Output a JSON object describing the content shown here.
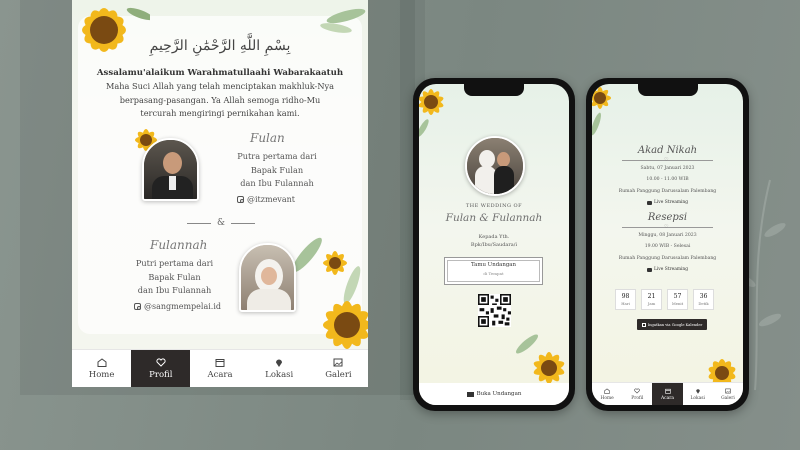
{
  "main_screen": {
    "calligraphy": "بِسْمِ اللَّهِ الرَّحْمَٰنِ الرَّحِيمِ",
    "greeting": "Assalamu'alaikum Warahmatullaahi Wabarakaatuh",
    "opening_lines": [
      "Maha Suci Allah yang telah menciptakan makhluk-Nya",
      "berpasang-pasangan. Ya Allah semoga ridho-Mu",
      "tercurah mengiringi pernikahan kami."
    ],
    "groom": {
      "name": "Fulan",
      "lines": [
        "Putra pertama dari",
        "Bapak Fulan",
        "dan Ibu Fulannah"
      ],
      "instagram": "@itzmevant"
    },
    "ampersand": "&",
    "bride": {
      "name": "Fulannah",
      "lines": [
        "Putri pertama dari",
        "Bapak Fulan",
        "dan Ibu Fulannah"
      ],
      "instagram": "@sangmempelai.id"
    },
    "nav": [
      {
        "label": "Home",
        "icon": "home-icon",
        "active": false
      },
      {
        "label": "Profil",
        "icon": "heart-icon",
        "active": true
      },
      {
        "label": "Acara",
        "icon": "calendar-icon",
        "active": false
      },
      {
        "label": "Lokasi",
        "icon": "map-pin-icon",
        "active": false
      },
      {
        "label": "Galeri",
        "icon": "image-icon",
        "active": false
      }
    ]
  },
  "cover_screen": {
    "subtitle": "THE WEDDING OF",
    "names": "Fulan & Fulannah",
    "to_label": "Kepada Yth.",
    "guest_label": "Bpk/Ibu/Saudara/i",
    "guest_box_title": "Tamu Undangan",
    "guest_box_place": "di Tempat",
    "open_button": "Buka Undangan"
  },
  "event_screen": {
    "akad": {
      "title": "Akad Nikah",
      "date": "Sabtu, 07 Januari 2023",
      "time": "10.00 - 11.00 WIB",
      "place": "Rumah Panggung Darussalam Palembang",
      "live": "Live Streaming"
    },
    "resepsi": {
      "title": "Resepsi",
      "date": "Minggu, 08 Januari 2023",
      "time": "19.00 WIB - Selesai",
      "place": "Rumah Panggung Darussalam Palembang",
      "live": "Live Streaming"
    },
    "countdown": [
      {
        "value": "98",
        "label": "Hari"
      },
      {
        "value": "21",
        "label": "Jam"
      },
      {
        "value": "57",
        "label": "Menit"
      },
      {
        "value": "36",
        "label": "Detik"
      }
    ],
    "calendar_button": "Ingatkan via Google Kalender",
    "nav": [
      {
        "label": "Home",
        "active": false
      },
      {
        "label": "Profil",
        "active": false
      },
      {
        "label": "Acara",
        "active": true
      },
      {
        "label": "Lokasi",
        "active": false
      },
      {
        "label": "Galeri",
        "active": false
      }
    ]
  },
  "colors": {
    "background": "#7d8983",
    "nav_active": "#2e2a29",
    "sunflower": "#f2b81c",
    "sunflower_center": "#7a4a12"
  }
}
